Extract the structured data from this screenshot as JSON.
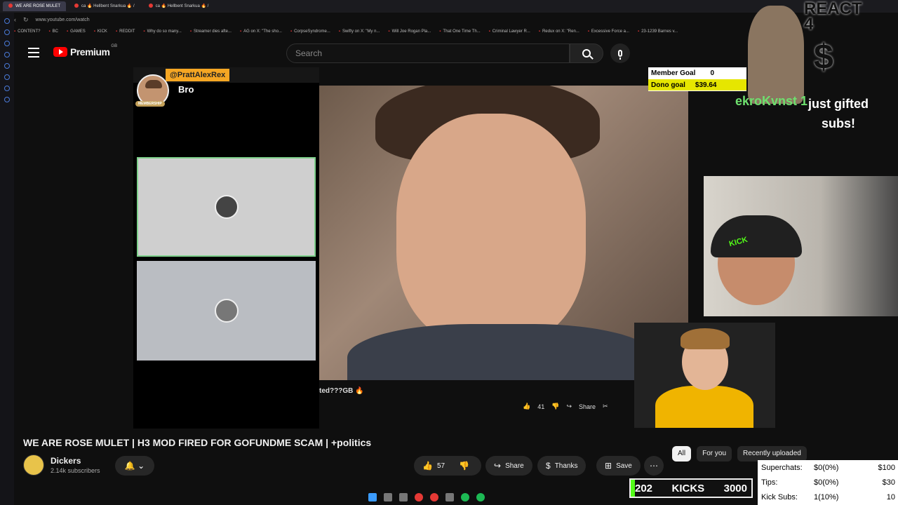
{
  "browser": {
    "tabs": [
      {
        "label": "WE ARE ROSE MULET",
        "active": true
      },
      {
        "label": "ca 🔥 Hellbent Snarkua 🔥 /",
        "active": false
      },
      {
        "label": "ca 🔥 Hellbent Snarkua 🔥 /",
        "active": false
      }
    ],
    "url": "www.youtube.com/watch",
    "bookmarks": [
      "CONTENT?",
      "BC",
      "GAMES",
      "KICK",
      "REDDIT",
      "Why do so many...",
      "Streamer dies afte...",
      "AG on X: \"The sho...",
      "CorpseSyndrome...",
      "Swifty on X: \"My n...",
      "Will Joe Rogan Pla...",
      "That One Time Th...",
      "Criminal Lawyer R...",
      "Redux on X: \"Ren...",
      "Excessive Force a...",
      "23-1239 Barnes v..."
    ]
  },
  "youtube": {
    "brand": "Premium",
    "region": "GB",
    "search_placeholder": "Search"
  },
  "call": {
    "handle": "@PrattAlexRex",
    "name": "Bro",
    "badge": "MEMBERSHIP"
  },
  "short": {
    "title": "ted???GB 🔥",
    "likes": "41",
    "share": "Share"
  },
  "goals": {
    "member_label": "Member Goal",
    "member_value": "0",
    "dono_label": "Dono goal",
    "dono_value": "$39.64"
  },
  "react_banner": {
    "title": "REACT",
    "number": "4",
    "symbol": "$"
  },
  "gift_alert": {
    "username": "ekroKvnst",
    "count": "1",
    "text": "just gifted subs!"
  },
  "video": {
    "title": "WE ARE ROSE MULET | H3 MOD FIRED FOR GOFUNDME SCAM | +politics",
    "channel": "Dickers",
    "subscribers": "2.14k subscribers",
    "likes": "57",
    "share": "Share",
    "thanks": "Thanks",
    "save": "Save"
  },
  "chips": [
    "All",
    "For you",
    "Recently uploaded"
  ],
  "stats": {
    "rows": [
      {
        "label": "Superchats:",
        "value": "$0(0%)",
        "goal": "$100"
      },
      {
        "label": "Tips:",
        "value": "$0(0%)",
        "goal": "$30"
      },
      {
        "label": "Kick Subs:",
        "value": "1(10%)",
        "goal": "10"
      }
    ],
    "kicks_current": "202",
    "kicks_label": "KICKS",
    "kicks_goal": "3000"
  },
  "icons": [
    "menu-icon",
    "search-icon",
    "mic-icon",
    "bell-icon",
    "chevron-down-icon",
    "like-icon",
    "dislike-icon",
    "share-icon",
    "thanks-icon",
    "save-icon",
    "more-icon"
  ],
  "colors": {
    "youtube_red": "#ff0000",
    "kick_green": "#53fc18",
    "goal_yellow": "#e6e600",
    "call_handle": "#f5a623"
  }
}
